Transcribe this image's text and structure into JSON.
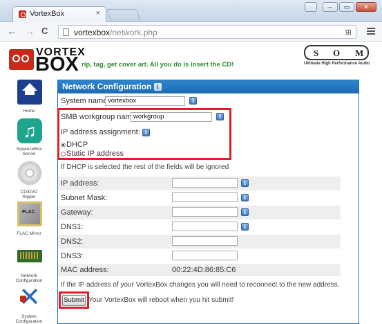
{
  "browser": {
    "tab_title": "VortexBox",
    "tab_close": "×",
    "url_host": "vortexbox",
    "url_path": "/network.php",
    "back_glyph": "←",
    "forward_glyph": "→",
    "reload_glyph": "C",
    "window_buttons": {
      "minimize": "–",
      "maximize": "▭",
      "close": "✕",
      "user": "👤"
    }
  },
  "header": {
    "logo_line1": "VORTEX",
    "logo_line2": "BOX",
    "tagline": "rip, tag, get cover art. All you do is insert the CD!",
    "som_letters": [
      "S",
      "O",
      "M"
    ],
    "som_subtitle": "Ultimate High Performance Audio"
  },
  "sidebar": {
    "items": [
      {
        "label": "Home",
        "icon": "home-icon"
      },
      {
        "label": "SqueezeBox Server",
        "icon": "squeezebox-icon"
      },
      {
        "label": "CD/DVD Ripper",
        "icon": "cd-icon"
      },
      {
        "label": "FLAC Mirror",
        "icon": "flac-icon"
      },
      {
        "label": "Network Configuration",
        "icon": "network-card-icon"
      },
      {
        "label": "System Configuration",
        "icon": "tools-icon"
      }
    ]
  },
  "panel": {
    "title": "Network Configuration",
    "info_glyph": "i",
    "system_name_label": "System name:",
    "system_name_value": "vortexbox",
    "smb_label": "SMB workgroup name:",
    "smb_value": "workgroup",
    "ip_assignment_label": "IP address assignment:",
    "dhcp_label": "DHCP",
    "static_label": "Static IP address",
    "dhcp_note": "If DHCP is selected the rest of the fields will be ignored",
    "ip_label": "IP address:",
    "subnet_label": "Subnet Mask:",
    "gateway_label": "Gateway:",
    "dns1_label": "DNS1:",
    "dns2_label": "DNS2:",
    "dns3_label": "DNS3:",
    "mac_label": "MAC address:",
    "mac_value": "00:22:4D:86:85:C6",
    "reconnect_note": "If the IP address of your VortexBox changes you will need to reconnect to the new address.",
    "submit_label": "Submit",
    "reboot_note": "Your VortexBox will reboot when you hit submit!"
  },
  "colors": {
    "header_blue": "#1d6bb1",
    "highlight_red": "#e01e2b",
    "tagline_green": "#2e8c2a"
  }
}
